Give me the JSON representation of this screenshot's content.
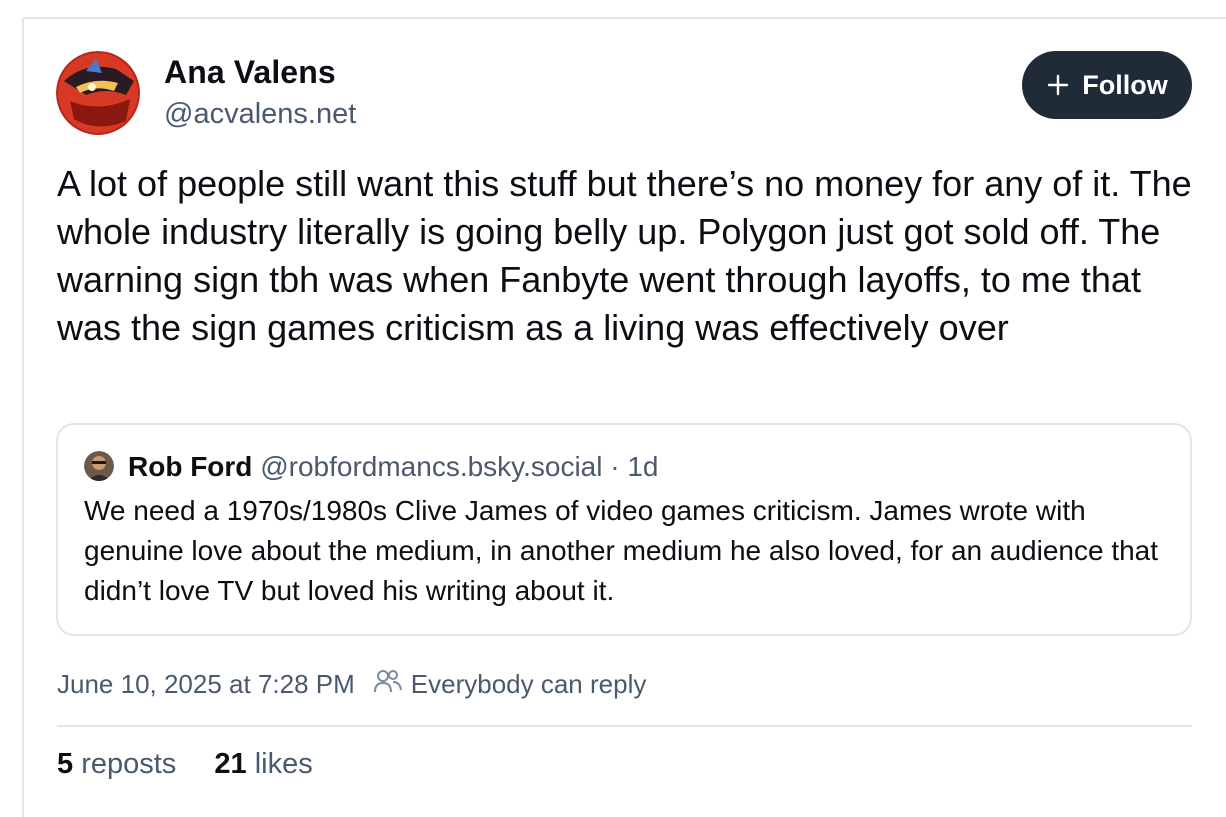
{
  "author": {
    "display_name": "Ana Valens",
    "handle": "@acvalens.net",
    "avatar_icon": "avatar-image"
  },
  "follow_button": {
    "label": "Follow",
    "icon": "plus-icon",
    "bg_color": "#1f2b37"
  },
  "post": {
    "text": "A lot of people still want this stuff but there’s no money for any of it. The whole industry literally is going belly up. Polygon just got sold off. The warning sign tbh was when Fanbyte went through layoffs, to me that was the sign games criticism as a living was effectively over"
  },
  "quote": {
    "author_name": "Rob Ford",
    "author_handle": "@robfordmancs.bsky.social",
    "separator": "·",
    "time": "1d",
    "text": "We need a 1970s/1980s Clive James of video games criticism. James wrote with genuine love about the medium, in another medium he also loved, for an audience that didn’t love TV but loved his writing about it."
  },
  "meta": {
    "timestamp": "June 10, 2025 at 7:28 PM",
    "reply_setting": "Everybody can reply",
    "reply_icon": "people-icon"
  },
  "stats": {
    "reposts_count": "5",
    "reposts_label": "reposts",
    "likes_count": "21",
    "likes_label": "likes"
  }
}
